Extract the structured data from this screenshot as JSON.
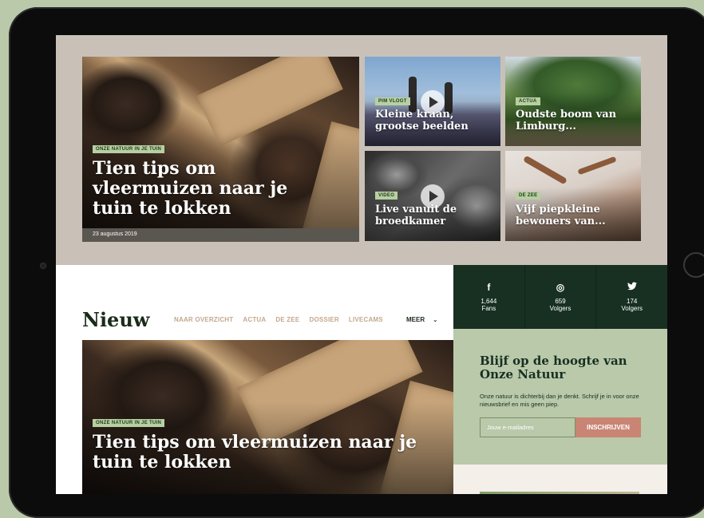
{
  "hero": {
    "main": {
      "tag": "ONZE NATUUR IN JE TUIN",
      "title": "Tien tips om vleermuizen naar je tuin te lokken",
      "date": "23 augustus 2019"
    },
    "cards": [
      {
        "tag": "PIM VLOGT",
        "title": "Kleine kraan, grootse beelden"
      },
      {
        "tag": "ACTUA",
        "title": "Oudste boom van Limburg..."
      },
      {
        "tag": "VIDEO",
        "title": "Live vanuit de broedkamer"
      },
      {
        "tag": "DE ZEE",
        "title": "Vijf piepkleine bewoners van..."
      }
    ]
  },
  "nieuw": {
    "title": "Nieuw",
    "nav": [
      "NAAR OVERZICHT",
      "ACTUA",
      "DE ZEE",
      "DOSSIER",
      "LIVECAMS"
    ],
    "more": "MEER",
    "feature": {
      "tag": "ONZE NATUUR IN JE TUIN",
      "title": "Tien tips om vleermuizen naar je tuin te lokken"
    }
  },
  "social": [
    {
      "icon": "facebook-icon",
      "glyph": "f",
      "count": "1,644",
      "label": "Fans"
    },
    {
      "icon": "instagram-icon",
      "glyph": "◎",
      "count": "659",
      "label": "Volgers"
    },
    {
      "icon": "twitter-icon",
      "glyph": "🐦",
      "count": "174",
      "label": "Volgers"
    }
  ],
  "newsletter": {
    "title": "Blijf op de hoogte van Onze Natuur",
    "text": "Onze natuur is dichterbij dan je denkt. Schrijf je in voor onze nieuwsbrief en mis geen piep.",
    "placeholder": "Jouw e-mailadres",
    "button": "INSCHRIJVEN"
  },
  "colors": {
    "dark_green": "#173022",
    "sage": "#b9c9a9",
    "tag_green": "#b7cfa1",
    "hero_bg": "#c9c1b8",
    "cta": "#c98574"
  }
}
